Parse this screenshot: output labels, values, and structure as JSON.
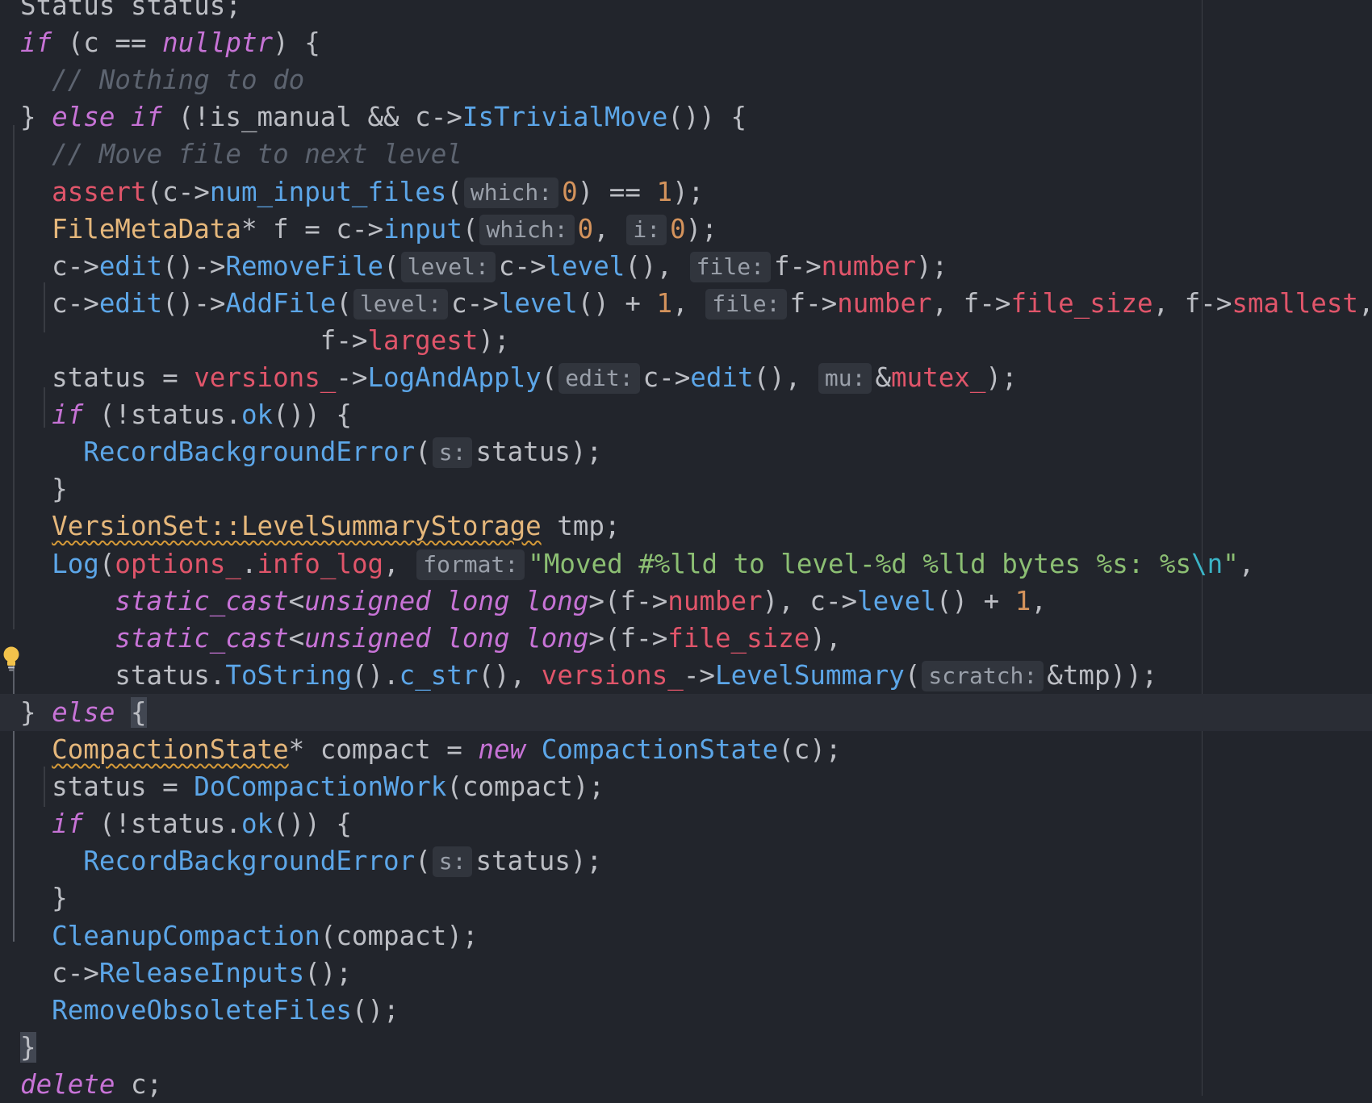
{
  "editor": {
    "colors": {
      "background": "#22252c",
      "current_line": "#2a2d35",
      "keyword": "#c773d6",
      "function": "#5ca6e8",
      "member": "#e0556a",
      "type": "#e5b77b",
      "number": "#d4935c",
      "string": "#8cbf73",
      "comment": "#5d6470",
      "default": "#bcbec4",
      "hint_background": "#31353d"
    },
    "bulb_icon": "lightbulb-icon",
    "lines": [
      {
        "tokens": [
          [
            "Status status;",
            "plain"
          ]
        ]
      },
      {
        "tokens": [
          [
            "if",
            "kw"
          ],
          [
            " (c == ",
            "plain"
          ],
          [
            "nullptr",
            "kw"
          ],
          [
            ") {",
            "plain"
          ]
        ]
      },
      {
        "tokens": [
          [
            "  ",
            "plain"
          ],
          [
            "// Nothing to do",
            "cmt"
          ]
        ]
      },
      {
        "tokens": [
          [
            "} ",
            "plain"
          ],
          [
            "else if",
            "kw"
          ],
          [
            " (!is_manual && c->",
            "plain"
          ],
          [
            "IsTrivialMove",
            "fn"
          ],
          [
            "()) {",
            "plain"
          ]
        ]
      },
      {
        "tokens": [
          [
            "  ",
            "plain"
          ],
          [
            "// Move file to next level",
            "cmt"
          ]
        ]
      },
      {
        "tokens": [
          [
            "  ",
            "plain"
          ],
          [
            "assert",
            "mac"
          ],
          [
            "(c->",
            "plain"
          ],
          [
            "num_input_files",
            "fn"
          ],
          [
            "(",
            "plain"
          ],
          [
            "which:",
            "hint"
          ],
          [
            "0",
            "num"
          ],
          [
            ") == ",
            "plain"
          ],
          [
            "1",
            "num"
          ],
          [
            ");",
            "plain"
          ]
        ]
      },
      {
        "tokens": [
          [
            "  ",
            "plain"
          ],
          [
            "FileMetaData",
            "typ"
          ],
          [
            "* f = c->",
            "plain"
          ],
          [
            "input",
            "fn"
          ],
          [
            "(",
            "plain"
          ],
          [
            "which:",
            "hint"
          ],
          [
            "0",
            "num"
          ],
          [
            ", ",
            "plain"
          ],
          [
            "i:",
            "hint"
          ],
          [
            "0",
            "num"
          ],
          [
            ");",
            "plain"
          ]
        ]
      },
      {
        "tokens": [
          [
            "  c->",
            "plain"
          ],
          [
            "edit",
            "fn"
          ],
          [
            "()->",
            "plain"
          ],
          [
            "RemoveFile",
            "fn"
          ],
          [
            "(",
            "plain"
          ],
          [
            "level:",
            "hint"
          ],
          [
            "c->",
            "plain"
          ],
          [
            "level",
            "fn"
          ],
          [
            "(), ",
            "plain"
          ],
          [
            "file:",
            "hint"
          ],
          [
            "f->",
            "plain"
          ],
          [
            "number",
            "mem"
          ],
          [
            ");",
            "plain"
          ]
        ]
      },
      {
        "tokens": [
          [
            "  c->",
            "plain"
          ],
          [
            "edit",
            "fn"
          ],
          [
            "()->",
            "plain"
          ],
          [
            "AddFile",
            "fn"
          ],
          [
            "(",
            "plain"
          ],
          [
            "level:",
            "hint"
          ],
          [
            "c->",
            "plain"
          ],
          [
            "level",
            "fn"
          ],
          [
            "() + ",
            "plain"
          ],
          [
            "1",
            "num"
          ],
          [
            ", ",
            "plain"
          ],
          [
            "file:",
            "hint"
          ],
          [
            "f->",
            "plain"
          ],
          [
            "number",
            "mem"
          ],
          [
            ", f->",
            "plain"
          ],
          [
            "file_size",
            "mem"
          ],
          [
            ", f->",
            "plain"
          ],
          [
            "smallest",
            "mem"
          ],
          [
            ",",
            "plain"
          ]
        ]
      },
      {
        "tokens": [
          [
            "                   f->",
            "plain"
          ],
          [
            "largest",
            "mem"
          ],
          [
            ");",
            "plain"
          ]
        ]
      },
      {
        "tokens": [
          [
            "  status = ",
            "plain"
          ],
          [
            "versions_",
            "mem"
          ],
          [
            "->",
            "plain"
          ],
          [
            "LogAndApply",
            "fn"
          ],
          [
            "(",
            "plain"
          ],
          [
            "edit:",
            "hint"
          ],
          [
            "c->",
            "plain"
          ],
          [
            "edit",
            "fn"
          ],
          [
            "(), ",
            "plain"
          ],
          [
            "mu:",
            "hint"
          ],
          [
            "&",
            "plain"
          ],
          [
            "mutex_",
            "mem"
          ],
          [
            ");",
            "plain"
          ]
        ]
      },
      {
        "tokens": [
          [
            "  ",
            "plain"
          ],
          [
            "if",
            "kw"
          ],
          [
            " (!status.",
            "plain"
          ],
          [
            "ok",
            "fn"
          ],
          [
            "()) {",
            "plain"
          ]
        ]
      },
      {
        "tokens": [
          [
            "    ",
            "plain"
          ],
          [
            "RecordBackgroundError",
            "fn"
          ],
          [
            "(",
            "plain"
          ],
          [
            "s:",
            "hint"
          ],
          [
            "status);",
            "plain"
          ]
        ]
      },
      {
        "tokens": [
          [
            "  }",
            "plain"
          ]
        ]
      },
      {
        "tokens": [
          [
            "  ",
            "plain"
          ],
          [
            "VersionSet::LevelSummaryStorage",
            "typ squig"
          ],
          [
            " tmp;",
            "plain"
          ]
        ]
      },
      {
        "tokens": [
          [
            "  ",
            "plain"
          ],
          [
            "Log",
            "fn"
          ],
          [
            "(",
            "plain"
          ],
          [
            "options_",
            "mem"
          ],
          [
            ".",
            "plain"
          ],
          [
            "info_log",
            "mem"
          ],
          [
            ", ",
            "plain"
          ],
          [
            "format:",
            "hint"
          ],
          [
            "\"Moved #%lld to level-%d %lld bytes %s: %s",
            "str"
          ],
          [
            "\\n",
            "esc"
          ],
          [
            "\"",
            "str"
          ],
          [
            ",",
            "plain"
          ]
        ]
      },
      {
        "tokens": [
          [
            "      ",
            "plain"
          ],
          [
            "static_cast",
            "kw"
          ],
          [
            "<",
            "plain"
          ],
          [
            "unsigned long long",
            "kw"
          ],
          [
            ">(f->",
            "plain"
          ],
          [
            "number",
            "mem"
          ],
          [
            "), c->",
            "plain"
          ],
          [
            "level",
            "fn"
          ],
          [
            "() + ",
            "plain"
          ],
          [
            "1",
            "num"
          ],
          [
            ",",
            "plain"
          ]
        ]
      },
      {
        "tokens": [
          [
            "      ",
            "plain"
          ],
          [
            "static_cast",
            "kw"
          ],
          [
            "<",
            "plain"
          ],
          [
            "unsigned long long",
            "kw"
          ],
          [
            ">(f->",
            "plain"
          ],
          [
            "file_size",
            "mem"
          ],
          [
            "),",
            "plain"
          ]
        ]
      },
      {
        "tokens": [
          [
            "      status.",
            "plain"
          ],
          [
            "ToString",
            "fn"
          ],
          [
            "().",
            "plain"
          ],
          [
            "c_str",
            "fn"
          ],
          [
            "(), ",
            "plain"
          ],
          [
            "versions_",
            "mem"
          ],
          [
            "->",
            "plain"
          ],
          [
            "LevelSummary",
            "fn"
          ],
          [
            "(",
            "plain"
          ],
          [
            "scratch:",
            "hint"
          ],
          [
            "&tmp));",
            "plain"
          ]
        ]
      },
      {
        "tokens": [
          [
            "} ",
            "plain"
          ],
          [
            "else",
            "kw"
          ],
          [
            " ",
            "plain"
          ],
          [
            "{",
            "hlbrace"
          ]
        ]
      },
      {
        "tokens": [
          [
            "  ",
            "plain"
          ],
          [
            "CompactionState",
            "typ squig"
          ],
          [
            "* compact = ",
            "plain"
          ],
          [
            "new",
            "kw"
          ],
          [
            " ",
            "plain"
          ],
          [
            "CompactionState",
            "fn"
          ],
          [
            "(c);",
            "plain"
          ]
        ]
      },
      {
        "tokens": [
          [
            "  status = ",
            "plain"
          ],
          [
            "DoCompactionWork",
            "fn"
          ],
          [
            "(compact);",
            "plain"
          ]
        ]
      },
      {
        "tokens": [
          [
            "  ",
            "plain"
          ],
          [
            "if",
            "kw"
          ],
          [
            " (!status.",
            "plain"
          ],
          [
            "ok",
            "fn"
          ],
          [
            "()) {",
            "plain"
          ]
        ]
      },
      {
        "tokens": [
          [
            "    ",
            "plain"
          ],
          [
            "RecordBackgroundError",
            "fn"
          ],
          [
            "(",
            "plain"
          ],
          [
            "s:",
            "hint"
          ],
          [
            "status);",
            "plain"
          ]
        ]
      },
      {
        "tokens": [
          [
            "  }",
            "plain"
          ]
        ]
      },
      {
        "tokens": [
          [
            "  ",
            "plain"
          ],
          [
            "CleanupCompaction",
            "fn"
          ],
          [
            "(compact);",
            "plain"
          ]
        ]
      },
      {
        "tokens": [
          [
            "  c->",
            "plain"
          ],
          [
            "ReleaseInputs",
            "fn"
          ],
          [
            "();",
            "plain"
          ]
        ]
      },
      {
        "tokens": [
          [
            "  ",
            "plain"
          ],
          [
            "RemoveObsoleteFiles",
            "fn"
          ],
          [
            "();",
            "plain"
          ]
        ]
      },
      {
        "tokens": [
          [
            "}",
            "hlbrace"
          ]
        ]
      },
      {
        "tokens": [
          [
            "delete",
            "kw"
          ],
          [
            " c;",
            "plain"
          ]
        ]
      }
    ]
  }
}
